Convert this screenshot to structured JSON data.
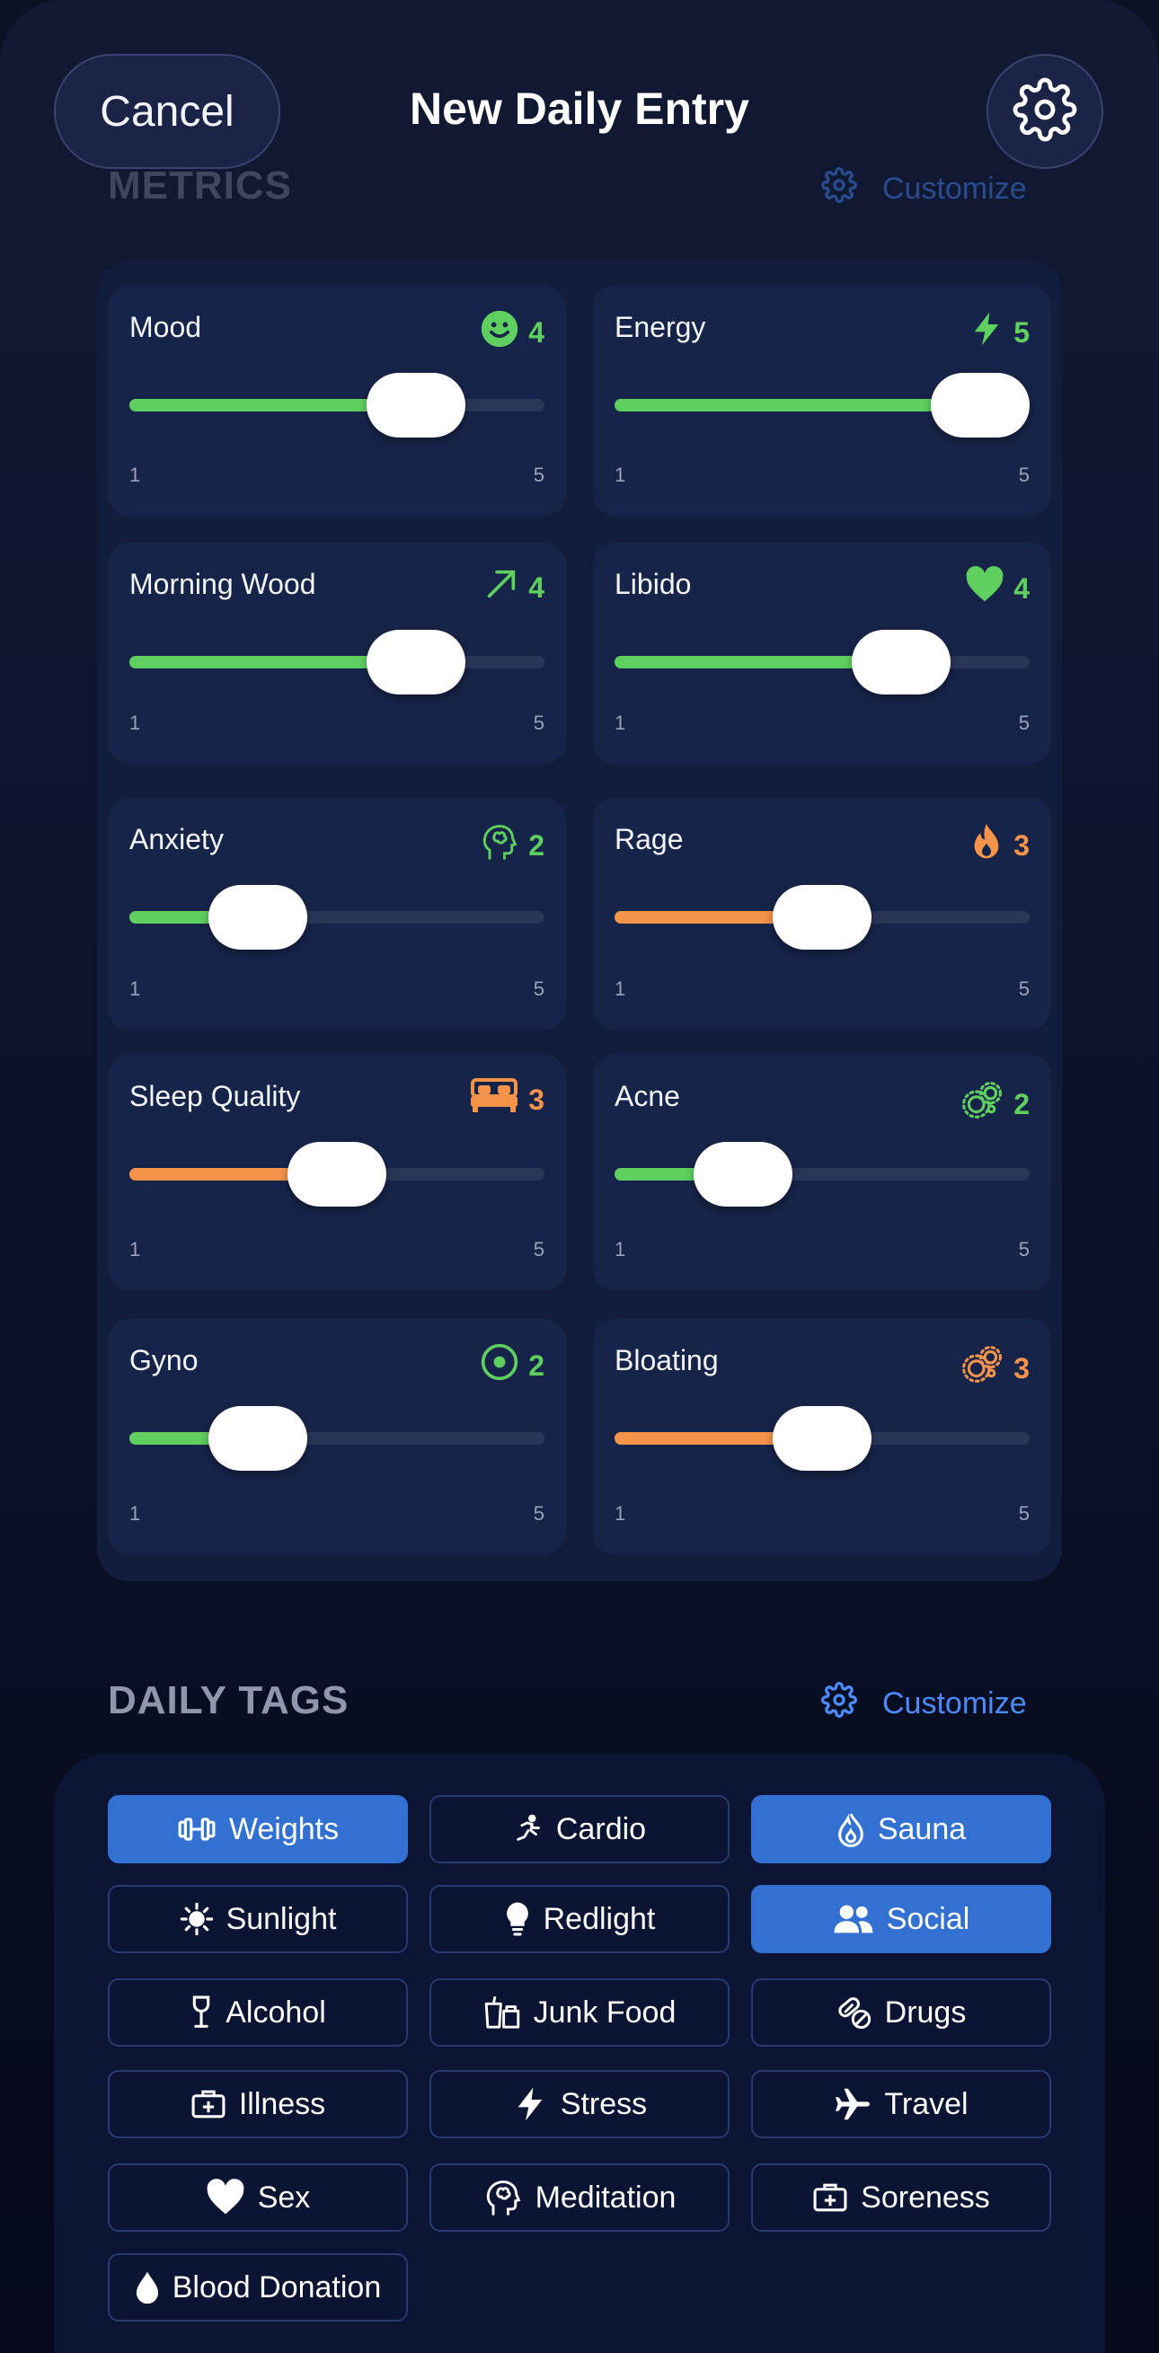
{
  "header": {
    "cancel_label": "Cancel",
    "title": "New Daily Entry",
    "settings_icon": "gear-icon"
  },
  "metrics": {
    "heading": "METRICS",
    "customize_label": "Customize",
    "items": [
      {
        "label": "Mood",
        "value": "4",
        "min": "1",
        "max": "5",
        "icon": "smiley-icon",
        "color": "#5fcf5f",
        "level": 4
      },
      {
        "label": "Energy",
        "value": "5",
        "min": "1",
        "max": "5",
        "icon": "lightning-icon",
        "color": "#5fcf5f",
        "level": 5
      },
      {
        "label": "Morning Wood",
        "value": "4",
        "min": "1",
        "max": "5",
        "icon": "arrow-up-right-icon",
        "color": "#5fcf5f",
        "level": 4
      },
      {
        "label": "Libido",
        "value": "4",
        "min": "1",
        "max": "5",
        "icon": "heart-icon",
        "color": "#5fcf5f",
        "level": 4
      },
      {
        "label": "Anxiety",
        "value": "2",
        "min": "1",
        "max": "5",
        "icon": "brain-head-icon",
        "color": "#5fcf5f",
        "level": 2
      },
      {
        "label": "Rage",
        "value": "3",
        "min": "1",
        "max": "5",
        "icon": "flame-icon",
        "color": "#f4934a",
        "level": 3
      },
      {
        "label": "Sleep Quality",
        "value": "3",
        "min": "1",
        "max": "5",
        "icon": "bed-icon",
        "color": "#f4934a",
        "level": 3
      },
      {
        "label": "Acne",
        "value": "2",
        "min": "1",
        "max": "5",
        "icon": "bubbles-icon",
        "color": "#5fcf5f",
        "level": 2
      },
      {
        "label": "Gyno",
        "value": "2",
        "min": "1",
        "max": "5",
        "icon": "target-icon",
        "color": "#5fcf5f",
        "level": 2
      },
      {
        "label": "Bloating",
        "value": "3",
        "min": "1",
        "max": "5",
        "icon": "bubbles-icon",
        "color": "#f4934a",
        "level": 3
      }
    ]
  },
  "tags": {
    "heading": "DAILY TAGS",
    "customize_label": "Customize",
    "items": [
      {
        "label": "Weights",
        "icon": "dumbbell-icon",
        "selected": true
      },
      {
        "label": "Cardio",
        "icon": "running-icon",
        "selected": false
      },
      {
        "label": "Sauna",
        "icon": "flame-drop-icon",
        "selected": true
      },
      {
        "label": "Sunlight",
        "icon": "sun-icon",
        "selected": false
      },
      {
        "label": "Redlight",
        "icon": "lightbulb-icon",
        "selected": false
      },
      {
        "label": "Social",
        "icon": "people-icon",
        "selected": true
      },
      {
        "label": "Alcohol",
        "icon": "wine-glass-icon",
        "selected": false
      },
      {
        "label": "Junk Food",
        "icon": "fast-food-icon",
        "selected": false
      },
      {
        "label": "Drugs",
        "icon": "pills-icon",
        "selected": false
      },
      {
        "label": "Illness",
        "icon": "medical-kit-icon",
        "selected": false
      },
      {
        "label": "Stress",
        "icon": "lightning-icon",
        "selected": false
      },
      {
        "label": "Travel",
        "icon": "airplane-icon",
        "selected": false
      },
      {
        "label": "Sex",
        "icon": "heart-icon",
        "selected": false
      },
      {
        "label": "Meditation",
        "icon": "brain-head-icon",
        "selected": false
      },
      {
        "label": "Soreness",
        "icon": "medical-kit-icon",
        "selected": false
      },
      {
        "label": "Blood Donation",
        "icon": "drop-icon",
        "selected": false
      }
    ]
  }
}
